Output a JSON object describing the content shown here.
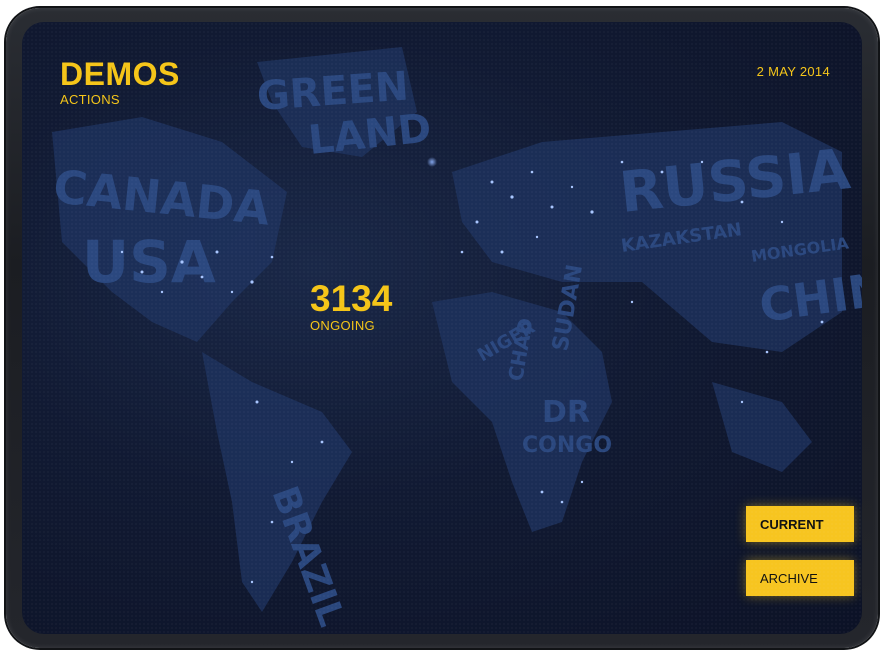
{
  "app": {
    "title": "DEMOS",
    "subtitle": "ACTIONS",
    "date": "2 MAY 2014"
  },
  "counter": {
    "value": "3134",
    "label": "ONGOING"
  },
  "buttons": {
    "current": "CURRENT",
    "archive": "ARCHIVE"
  },
  "map": {
    "countries": [
      "GREEN",
      "LAND",
      "CANADA",
      "USA",
      "RUSSIA",
      "KAZAKSTAN",
      "MONGOLIA",
      "CHINA",
      "BRAZIL",
      "DR",
      "CONGO",
      "CHAD",
      "NIGER",
      "SUDAN"
    ]
  },
  "colors": {
    "accent": "#f5c518",
    "screen_bg": "#111a33",
    "country_text": "#2c4a82"
  }
}
